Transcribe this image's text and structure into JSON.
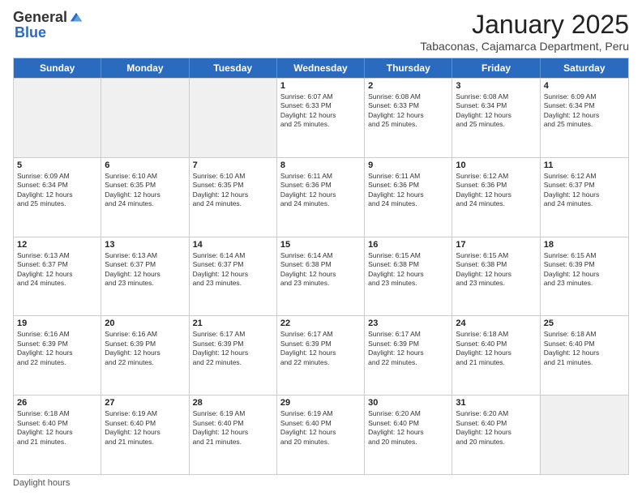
{
  "logo": {
    "general": "General",
    "blue": "Blue"
  },
  "header": {
    "month": "January 2025",
    "location": "Tabaconas, Cajamarca Department, Peru"
  },
  "days_of_week": [
    "Sunday",
    "Monday",
    "Tuesday",
    "Wednesday",
    "Thursday",
    "Friday",
    "Saturday"
  ],
  "footer": {
    "daylight_label": "Daylight hours"
  },
  "weeks": [
    [
      {
        "day": "",
        "info": ""
      },
      {
        "day": "",
        "info": ""
      },
      {
        "day": "",
        "info": ""
      },
      {
        "day": "1",
        "info": "Sunrise: 6:07 AM\nSunset: 6:33 PM\nDaylight: 12 hours\nand 25 minutes."
      },
      {
        "day": "2",
        "info": "Sunrise: 6:08 AM\nSunset: 6:33 PM\nDaylight: 12 hours\nand 25 minutes."
      },
      {
        "day": "3",
        "info": "Sunrise: 6:08 AM\nSunset: 6:34 PM\nDaylight: 12 hours\nand 25 minutes."
      },
      {
        "day": "4",
        "info": "Sunrise: 6:09 AM\nSunset: 6:34 PM\nDaylight: 12 hours\nand 25 minutes."
      }
    ],
    [
      {
        "day": "5",
        "info": "Sunrise: 6:09 AM\nSunset: 6:34 PM\nDaylight: 12 hours\nand 25 minutes."
      },
      {
        "day": "6",
        "info": "Sunrise: 6:10 AM\nSunset: 6:35 PM\nDaylight: 12 hours\nand 24 minutes."
      },
      {
        "day": "7",
        "info": "Sunrise: 6:10 AM\nSunset: 6:35 PM\nDaylight: 12 hours\nand 24 minutes."
      },
      {
        "day": "8",
        "info": "Sunrise: 6:11 AM\nSunset: 6:36 PM\nDaylight: 12 hours\nand 24 minutes."
      },
      {
        "day": "9",
        "info": "Sunrise: 6:11 AM\nSunset: 6:36 PM\nDaylight: 12 hours\nand 24 minutes."
      },
      {
        "day": "10",
        "info": "Sunrise: 6:12 AM\nSunset: 6:36 PM\nDaylight: 12 hours\nand 24 minutes."
      },
      {
        "day": "11",
        "info": "Sunrise: 6:12 AM\nSunset: 6:37 PM\nDaylight: 12 hours\nand 24 minutes."
      }
    ],
    [
      {
        "day": "12",
        "info": "Sunrise: 6:13 AM\nSunset: 6:37 PM\nDaylight: 12 hours\nand 24 minutes."
      },
      {
        "day": "13",
        "info": "Sunrise: 6:13 AM\nSunset: 6:37 PM\nDaylight: 12 hours\nand 23 minutes."
      },
      {
        "day": "14",
        "info": "Sunrise: 6:14 AM\nSunset: 6:37 PM\nDaylight: 12 hours\nand 23 minutes."
      },
      {
        "day": "15",
        "info": "Sunrise: 6:14 AM\nSunset: 6:38 PM\nDaylight: 12 hours\nand 23 minutes."
      },
      {
        "day": "16",
        "info": "Sunrise: 6:15 AM\nSunset: 6:38 PM\nDaylight: 12 hours\nand 23 minutes."
      },
      {
        "day": "17",
        "info": "Sunrise: 6:15 AM\nSunset: 6:38 PM\nDaylight: 12 hours\nand 23 minutes."
      },
      {
        "day": "18",
        "info": "Sunrise: 6:15 AM\nSunset: 6:39 PM\nDaylight: 12 hours\nand 23 minutes."
      }
    ],
    [
      {
        "day": "19",
        "info": "Sunrise: 6:16 AM\nSunset: 6:39 PM\nDaylight: 12 hours\nand 22 minutes."
      },
      {
        "day": "20",
        "info": "Sunrise: 6:16 AM\nSunset: 6:39 PM\nDaylight: 12 hours\nand 22 minutes."
      },
      {
        "day": "21",
        "info": "Sunrise: 6:17 AM\nSunset: 6:39 PM\nDaylight: 12 hours\nand 22 minutes."
      },
      {
        "day": "22",
        "info": "Sunrise: 6:17 AM\nSunset: 6:39 PM\nDaylight: 12 hours\nand 22 minutes."
      },
      {
        "day": "23",
        "info": "Sunrise: 6:17 AM\nSunset: 6:39 PM\nDaylight: 12 hours\nand 22 minutes."
      },
      {
        "day": "24",
        "info": "Sunrise: 6:18 AM\nSunset: 6:40 PM\nDaylight: 12 hours\nand 21 minutes."
      },
      {
        "day": "25",
        "info": "Sunrise: 6:18 AM\nSunset: 6:40 PM\nDaylight: 12 hours\nand 21 minutes."
      }
    ],
    [
      {
        "day": "26",
        "info": "Sunrise: 6:18 AM\nSunset: 6:40 PM\nDaylight: 12 hours\nand 21 minutes."
      },
      {
        "day": "27",
        "info": "Sunrise: 6:19 AM\nSunset: 6:40 PM\nDaylight: 12 hours\nand 21 minutes."
      },
      {
        "day": "28",
        "info": "Sunrise: 6:19 AM\nSunset: 6:40 PM\nDaylight: 12 hours\nand 21 minutes."
      },
      {
        "day": "29",
        "info": "Sunrise: 6:19 AM\nSunset: 6:40 PM\nDaylight: 12 hours\nand 20 minutes."
      },
      {
        "day": "30",
        "info": "Sunrise: 6:20 AM\nSunset: 6:40 PM\nDaylight: 12 hours\nand 20 minutes."
      },
      {
        "day": "31",
        "info": "Sunrise: 6:20 AM\nSunset: 6:40 PM\nDaylight: 12 hours\nand 20 minutes."
      },
      {
        "day": "",
        "info": ""
      }
    ]
  ]
}
